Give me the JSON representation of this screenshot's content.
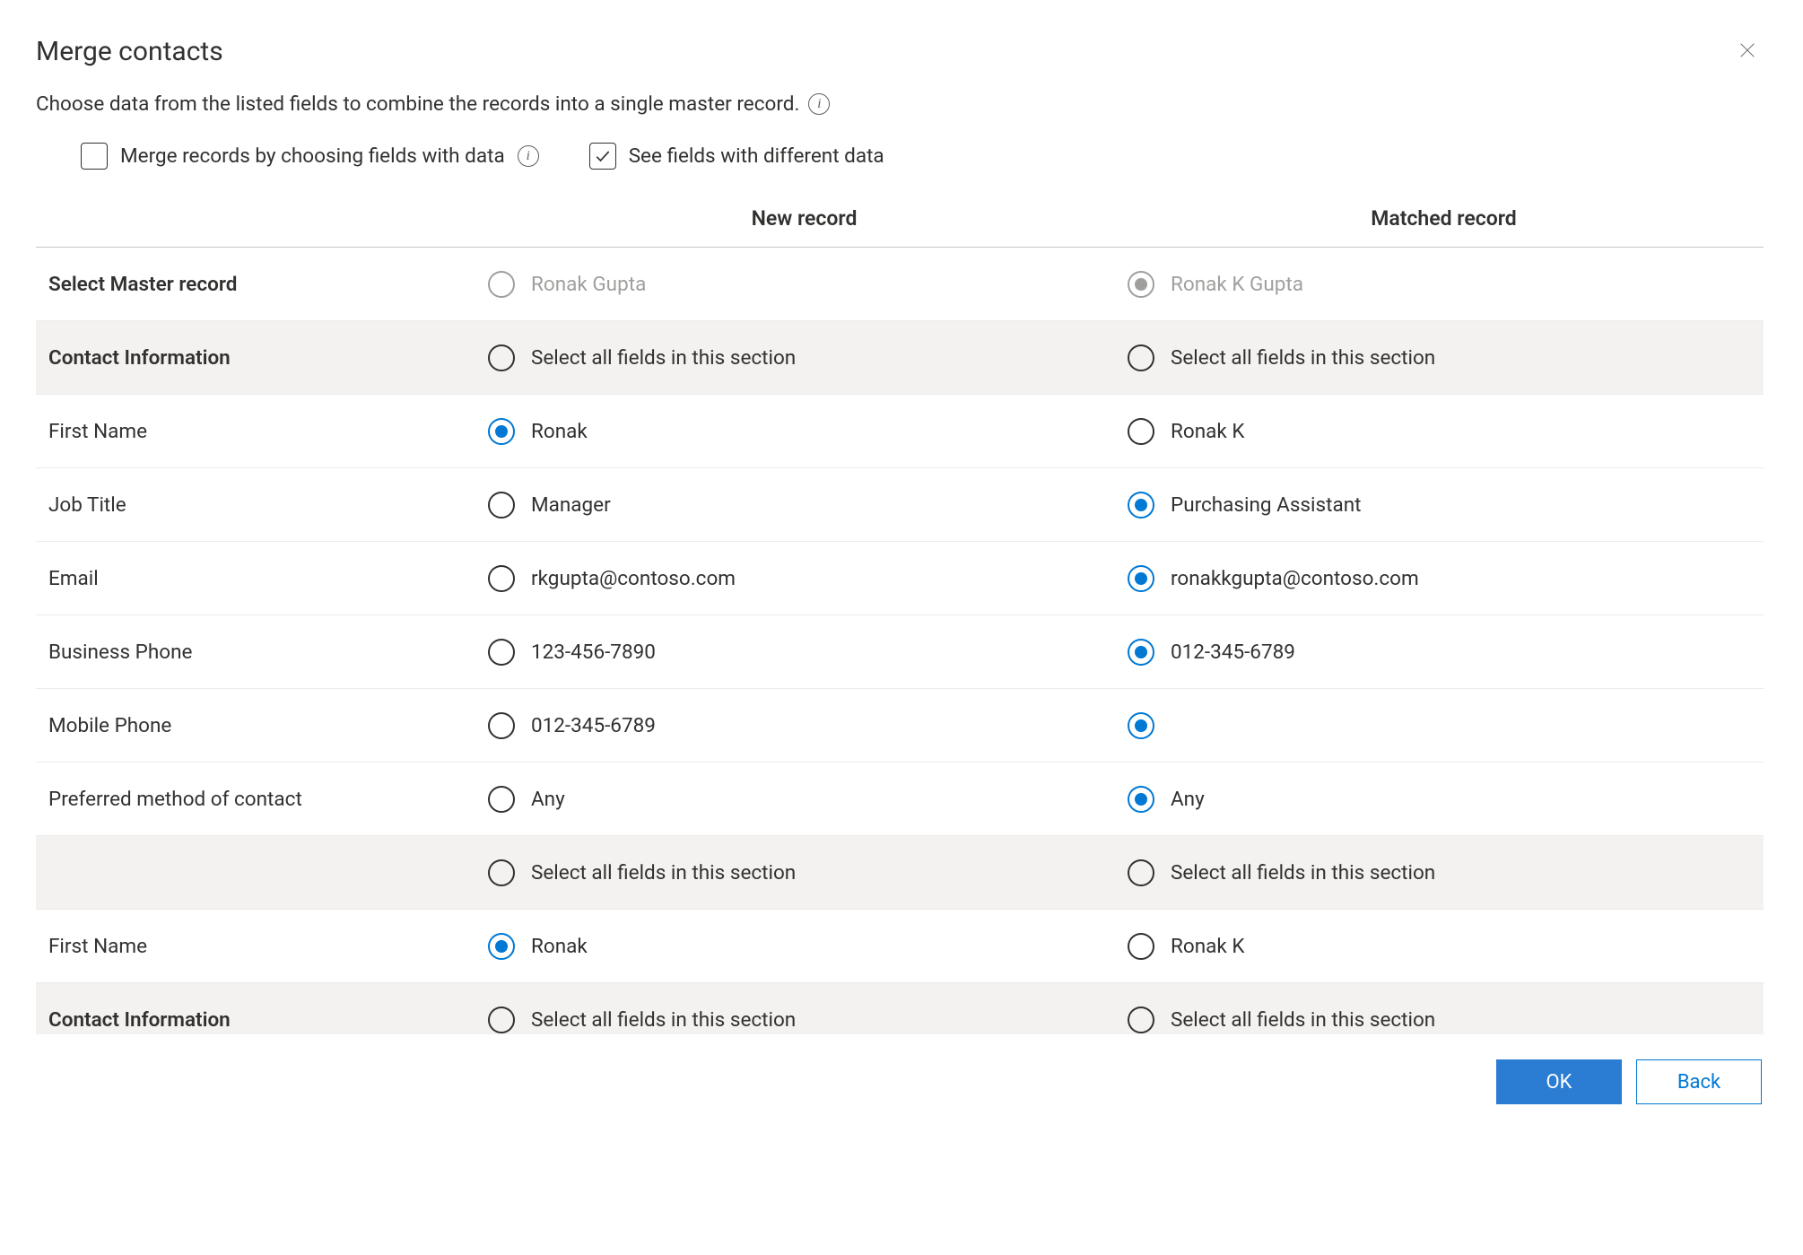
{
  "dialog": {
    "title": "Merge contacts",
    "subtitle": "Choose data from the listed fields to combine the records into a single master record.",
    "options": {
      "merge_by_fields_label": "Merge records by choosing fields with data",
      "merge_by_fields_checked": false,
      "see_diff_label": "See fields with different data",
      "see_diff_checked": true
    },
    "columns": {
      "new": "New record",
      "matched": "Matched record"
    },
    "master_row_label": "Select Master record",
    "master_new": {
      "value": "Ronak Gupta",
      "selected": false,
      "disabled": true
    },
    "master_matched": {
      "value": "Ronak K Gupta",
      "selected": true,
      "disabled": true
    },
    "rows": [
      {
        "type": "section",
        "label": "Contact Information",
        "new": {
          "value": "Select all fields in this section",
          "selected": false
        },
        "matched": {
          "value": "Select all fields in this section",
          "selected": false
        }
      },
      {
        "type": "field",
        "label": "First Name",
        "new": {
          "value": "Ronak",
          "selected": true
        },
        "matched": {
          "value": "Ronak K",
          "selected": false
        }
      },
      {
        "type": "field",
        "label": "Job Title",
        "new": {
          "value": "Manager",
          "selected": false
        },
        "matched": {
          "value": "Purchasing Assistant",
          "selected": true
        }
      },
      {
        "type": "field",
        "label": "Email",
        "new": {
          "value": "rkgupta@contoso.com",
          "selected": false
        },
        "matched": {
          "value": "ronakkgupta@contoso.com",
          "selected": true
        }
      },
      {
        "type": "field",
        "label": "Business Phone",
        "new": {
          "value": "123-456-7890",
          "selected": false
        },
        "matched": {
          "value": "012-345-6789",
          "selected": true
        }
      },
      {
        "type": "field",
        "label": "Mobile Phone",
        "new": {
          "value": "012-345-6789",
          "selected": false
        },
        "matched": {
          "value": "",
          "selected": true
        }
      },
      {
        "type": "field",
        "label": "Preferred method of contact",
        "new": {
          "value": "Any",
          "selected": false
        },
        "matched": {
          "value": "Any",
          "selected": true
        }
      },
      {
        "type": "section",
        "label": "",
        "new": {
          "value": "Select all fields in this section",
          "selected": false
        },
        "matched": {
          "value": "Select all fields in this section",
          "selected": false
        }
      },
      {
        "type": "field",
        "label": "First Name",
        "new": {
          "value": "Ronak",
          "selected": true
        },
        "matched": {
          "value": "Ronak K",
          "selected": false
        }
      },
      {
        "type": "section-partial",
        "label": "Contact Information",
        "new": {
          "value": "Select all fields in this section",
          "selected": false
        },
        "matched": {
          "value": "Select all fields in this section",
          "selected": false
        }
      }
    ],
    "buttons": {
      "ok": "OK",
      "back": "Back"
    }
  }
}
